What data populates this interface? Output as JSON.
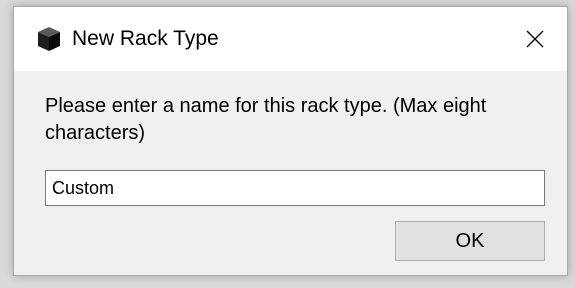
{
  "dialog": {
    "title": "New Rack Type",
    "message": "Please enter a name for this rack type. (Max eight characters)",
    "name_input": {
      "value": "Custom",
      "placeholder": ""
    },
    "ok_label": "OK",
    "icons": {
      "app": "cube-icon",
      "close": "close-icon"
    }
  }
}
